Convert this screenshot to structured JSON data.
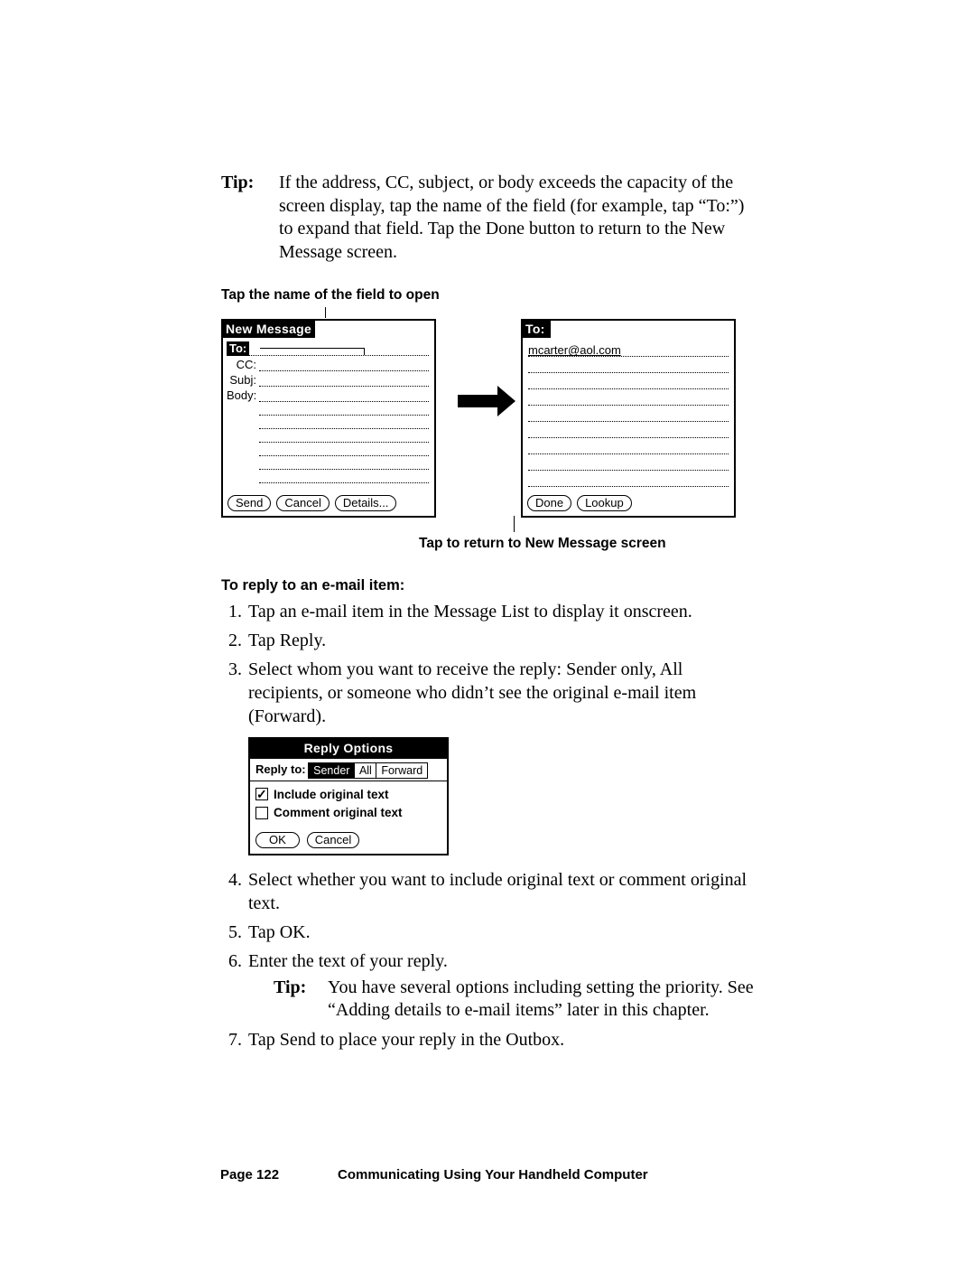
{
  "tip1": {
    "label": "Tip:",
    "text": "If the address, CC, subject, or body exceeds the capacity of the screen display, tap the name of the field (for example, tap “To:”) to expand that field. Tap the Done button to return to the New Message screen."
  },
  "captions": {
    "top": "Tap the name of the field to open",
    "bottom": "Tap to return to New Message screen"
  },
  "newMessage": {
    "title": "New Message",
    "fields": {
      "to": "To:",
      "cc": "CC:",
      "subj": "Subj:",
      "body": "Body:"
    },
    "buttons": {
      "send": "Send",
      "cancel": "Cancel",
      "details": "Details..."
    }
  },
  "toScreen": {
    "title": "To:",
    "email": "mcarter@aol.com",
    "buttons": {
      "done": "Done",
      "lookup": "Lookup"
    }
  },
  "proc": {
    "heading": "To reply to an e-mail item:",
    "steps": {
      "s1": "Tap an e-mail item in the Message List to display it onscreen.",
      "s2": "Tap Reply.",
      "s3": "Select whom you want to receive the reply: Sender only, All recipients, or someone who didn’t see the original e-mail item (Forward).",
      "s4": "Select whether you want to include original text or comment original text.",
      "s5": "Tap OK.",
      "s6": "Enter the text of your reply.",
      "s7": "Tap Send to place your reply in the Outbox."
    }
  },
  "tip2": {
    "label": "Tip:",
    "text": "You have several options including setting the priority. See “Adding details to e-mail items” later in this chapter."
  },
  "replyDialog": {
    "title": "Reply Options",
    "label": "Reply to:",
    "opts": {
      "sender": "Sender",
      "all": "All",
      "forward": "Forward"
    },
    "chk1": "Include original text",
    "chk2": "Comment original text",
    "buttons": {
      "ok": "OK",
      "cancel": "Cancel"
    }
  },
  "footer": {
    "page": "Page 122",
    "chapter": "Communicating Using Your Handheld Computer"
  }
}
